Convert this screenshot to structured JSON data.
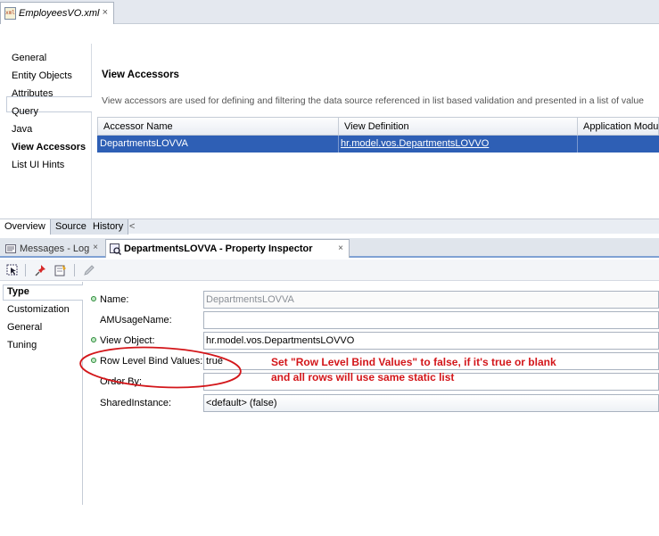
{
  "editor": {
    "file_tab": {
      "label": "EmployeesVO.xml",
      "icon": "xml-file-icon",
      "close": "×"
    },
    "left_nav": {
      "items": [
        "General",
        "Entity Objects",
        "Attributes",
        "Query",
        "Java",
        "View Accessors",
        "List UI Hints"
      ],
      "selected_index": 5
    },
    "title": "View Accessors",
    "description": "View accessors are used for defining and filtering the data source referenced in list based validation and presented in a list of value",
    "table": {
      "columns": [
        "Accessor Name",
        "View Definition",
        "Application Module"
      ],
      "rows": [
        {
          "accessor_name": "DepartmentsLOVVA",
          "view_definition": "hr.model.vos.DepartmentsLOVVO",
          "application_module": ""
        }
      ]
    },
    "bottom_tabs": [
      "Overview",
      "Source",
      "History"
    ],
    "bottom_tabs_arrow": "<"
  },
  "property_inspector": {
    "tabs": [
      {
        "label": "Messages - Log",
        "close": "×",
        "icon": "messages-log-icon"
      },
      {
        "label": "DepartmentsLOVVA - Property Inspector",
        "close": "×",
        "icon": "property-inspector-icon"
      }
    ],
    "toolbar_icons": [
      "select-icon",
      "pin-icon",
      "edit-properties-icon",
      "pencil-icon"
    ],
    "nav": {
      "items": [
        "Type",
        "Customization",
        "General",
        "Tuning"
      ],
      "selected_index": 0
    },
    "properties": [
      {
        "label": "Name:",
        "value": "DepartmentsLOVVA",
        "required": true,
        "disabled": true
      },
      {
        "label": "AMUsageName:",
        "value": "",
        "required": false
      },
      {
        "label": "View Object:",
        "value": "hr.model.vos.DepartmentsLOVVO",
        "required": true
      },
      {
        "label": "Row Level Bind Values:",
        "value": "true",
        "required": true
      },
      {
        "label": "Order By:",
        "value": "",
        "required": false
      },
      {
        "label": "SharedInstance:",
        "value": "<default> (false)",
        "required": false,
        "select": true
      }
    ]
  },
  "annotation": {
    "text": "Set \"Row Level Bind Values\" to false, if it's true or blank and all rows will use same static list",
    "color": "#d3161a"
  },
  "colors": {
    "selection": "#2e5fb5",
    "accent_border": "#7fa1d3",
    "required_dot": "#2e8b3a"
  }
}
